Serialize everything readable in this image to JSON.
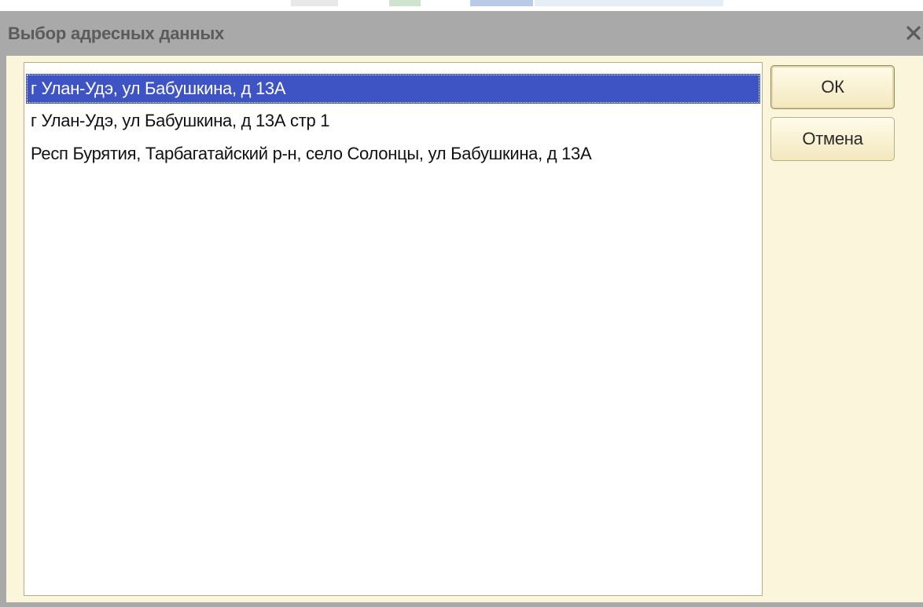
{
  "dialog": {
    "title": "Выбор адресных данных",
    "close_glyph": "×",
    "close_icon": "close-icon"
  },
  "address_list": {
    "items": [
      {
        "label": "г Улан-Удэ, ул Бабушкина, д 13А",
        "selected": true
      },
      {
        "label": "г Улан-Удэ, ул Бабушкина, д 13А стр 1",
        "selected": false
      },
      {
        "label": "Респ Бурятия, Тарбагатайский р-н, село Солонцы, ул Бабушкина, д 13А",
        "selected": false
      }
    ]
  },
  "buttons": {
    "ok_label": "ОК",
    "cancel_label": "Отмена"
  },
  "colors": {
    "titlebar": "#a9a9a9",
    "dialog_background": "#fbf5dc",
    "selection": "#3f54c4",
    "list_background": "#ffffff"
  }
}
